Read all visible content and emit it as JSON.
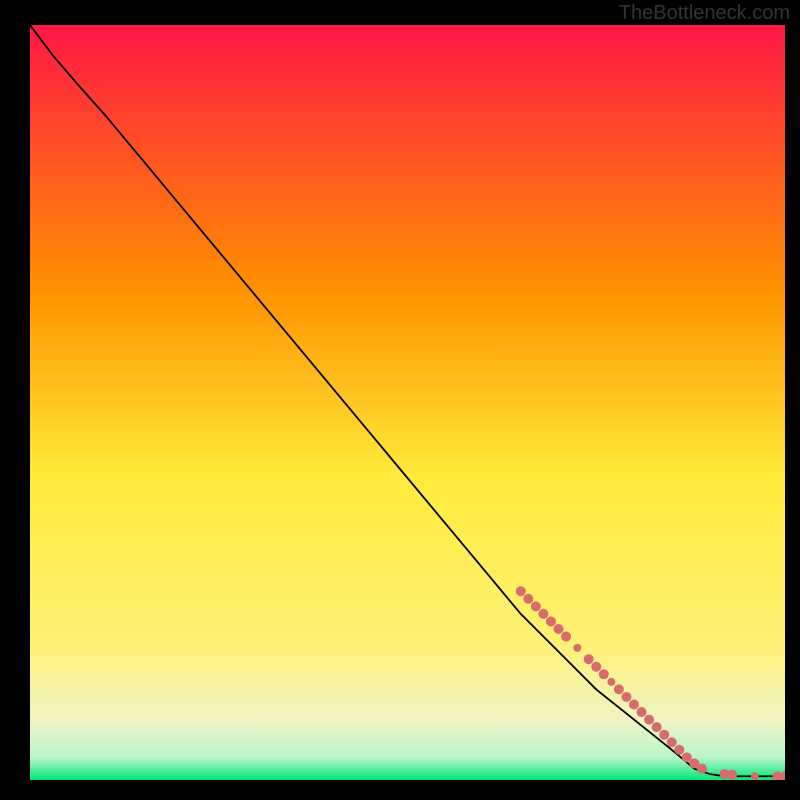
{
  "attribution": "TheBottleneck.com",
  "chart_data": {
    "type": "line",
    "title": "",
    "xlabel": "",
    "ylabel": "",
    "xlim": [
      0,
      100
    ],
    "ylim": [
      0,
      100
    ],
    "gradient_colors": {
      "top": "#ff1744",
      "mid_upper": "#ff9800",
      "mid": "#ffeb3b",
      "mid_lower": "#fff59d",
      "bottom": "#00e676"
    },
    "line_points": [
      {
        "x": 0,
        "y": 100
      },
      {
        "x": 3,
        "y": 96
      },
      {
        "x": 6,
        "y": 92.5
      },
      {
        "x": 10,
        "y": 88
      },
      {
        "x": 20,
        "y": 76
      },
      {
        "x": 30,
        "y": 64
      },
      {
        "x": 40,
        "y": 52
      },
      {
        "x": 50,
        "y": 40
      },
      {
        "x": 60,
        "y": 28
      },
      {
        "x": 65,
        "y": 22
      },
      {
        "x": 70,
        "y": 17
      },
      {
        "x": 75,
        "y": 12
      },
      {
        "x": 80,
        "y": 8
      },
      {
        "x": 85,
        "y": 4
      },
      {
        "x": 88,
        "y": 1.5
      },
      {
        "x": 90,
        "y": 0.8
      },
      {
        "x": 92,
        "y": 0.5
      },
      {
        "x": 95,
        "y": 0.5
      },
      {
        "x": 98,
        "y": 0.5
      },
      {
        "x": 100,
        "y": 0.5
      }
    ],
    "markers": [
      {
        "x": 65,
        "y": 25,
        "size": 5
      },
      {
        "x": 66,
        "y": 24,
        "size": 5
      },
      {
        "x": 67,
        "y": 23,
        "size": 5
      },
      {
        "x": 68,
        "y": 22,
        "size": 5
      },
      {
        "x": 69,
        "y": 21,
        "size": 5
      },
      {
        "x": 70,
        "y": 20,
        "size": 5
      },
      {
        "x": 71,
        "y": 19,
        "size": 5
      },
      {
        "x": 72.5,
        "y": 17.5,
        "size": 4
      },
      {
        "x": 74,
        "y": 16,
        "size": 5
      },
      {
        "x": 75,
        "y": 15,
        "size": 5
      },
      {
        "x": 76,
        "y": 14,
        "size": 5
      },
      {
        "x": 77,
        "y": 13,
        "size": 4
      },
      {
        "x": 78,
        "y": 12,
        "size": 5
      },
      {
        "x": 79,
        "y": 11,
        "size": 5
      },
      {
        "x": 80,
        "y": 10,
        "size": 5
      },
      {
        "x": 81,
        "y": 9,
        "size": 5
      },
      {
        "x": 82,
        "y": 8,
        "size": 5
      },
      {
        "x": 83,
        "y": 7,
        "size": 5
      },
      {
        "x": 84,
        "y": 6,
        "size": 5
      },
      {
        "x": 85,
        "y": 5,
        "size": 5
      },
      {
        "x": 86,
        "y": 4,
        "size": 5
      },
      {
        "x": 87,
        "y": 3,
        "size": 5
      },
      {
        "x": 88,
        "y": 2.2,
        "size": 5
      },
      {
        "x": 89,
        "y": 1.5,
        "size": 5
      },
      {
        "x": 92,
        "y": 0.8,
        "size": 5
      },
      {
        "x": 93,
        "y": 0.7,
        "size": 5
      },
      {
        "x": 96,
        "y": 0.5,
        "size": 4
      },
      {
        "x": 99,
        "y": 0.5,
        "size": 5
      },
      {
        "x": 100,
        "y": 0.5,
        "size": 5
      }
    ],
    "marker_color": "#d86b6b"
  }
}
